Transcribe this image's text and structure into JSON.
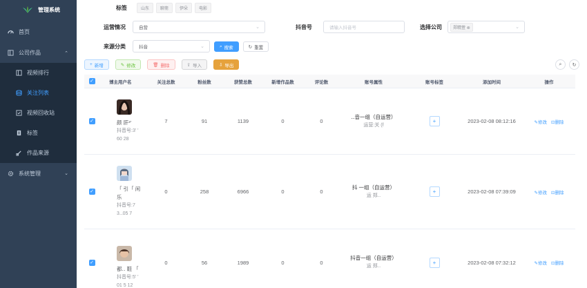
{
  "app": {
    "title": "管理系统"
  },
  "sidebar": {
    "items": [
      {
        "label": "首页",
        "icon": "dashboard-icon"
      },
      {
        "label": "公司作品",
        "icon": "book-icon"
      },
      {
        "label": "视频排行",
        "icon": "ranking-icon"
      },
      {
        "label": "关注列表",
        "icon": "list-icon"
      },
      {
        "label": "视频回收站",
        "icon": "checkbox-icon"
      },
      {
        "label": "标签",
        "icon": "tag-icon"
      },
      {
        "label": "作品来源",
        "icon": "source-icon"
      },
      {
        "label": "系统管理",
        "icon": "gear-icon"
      }
    ]
  },
  "filters": {
    "tag_label": "标签",
    "tags": [
      "山东",
      "聊斋",
      "伊朵",
      "电影"
    ],
    "operation_label": "运营情况",
    "operation_value": "自营",
    "douyin_label": "抖音号",
    "douyin_placeholder": "请输入抖音号",
    "company_label": "选择公司",
    "company_chip": "郑精萱",
    "source_label": "来源分类",
    "source_value": "抖音",
    "search_btn": "搜索",
    "reset_btn": "重置"
  },
  "toolbar": {
    "add": "新增",
    "edit": "修改",
    "delete": "删除",
    "import": "导入",
    "export": "导出"
  },
  "table": {
    "headers": [
      "博主用户名",
      "关注总数",
      "粉丝数",
      "获赞总数",
      "新增作品数",
      "评论数",
      "账号属性",
      "账号标签",
      "添加时间",
      "操作"
    ],
    "edit_label": "修改",
    "delete_label": "删除",
    "rows": [
      {
        "name1": "颜   肝³'",
        "name2": "",
        "douyin": "抖音号:3'  '",
        "douyin2": "60    28",
        "follow": "7",
        "fans": "91",
        "likes": "1139",
        "new_works": "0",
        "comments": "0",
        "attr1": "‥音一组（自运营）",
        "attr2": "运营:关   (f",
        "time": "2023-02-08 08:12:16"
      },
      {
        "name1": "「  引「  闲",
        "name2": "乐",
        "douyin": "抖音号:7",
        "douyin2": "3‥05    7",
        "follow": "0",
        "fans": "258",
        "likes": "6966",
        "new_works": "0",
        "comments": "0",
        "attr1": "抖   一组（自运营）",
        "attr2": "运   郑‥",
        "time": "2023-02-08 07:39:09"
      },
      {
        "name1": "都‥  鞋    「",
        "name2": "",
        "douyin": "抖音号:5'  '",
        "douyin2": "01    5    12",
        "follow": "0",
        "fans": "56",
        "likes": "1989",
        "new_works": "0",
        "comments": "0",
        "attr1": "抖音一组（自运营）",
        "attr2": "运   郑‥",
        "time": "2023-02-08 07:32:12"
      }
    ]
  },
  "colors": {
    "sidebar_bg": "#304156",
    "primary": "#409eff",
    "warning": "#e6a23c"
  }
}
